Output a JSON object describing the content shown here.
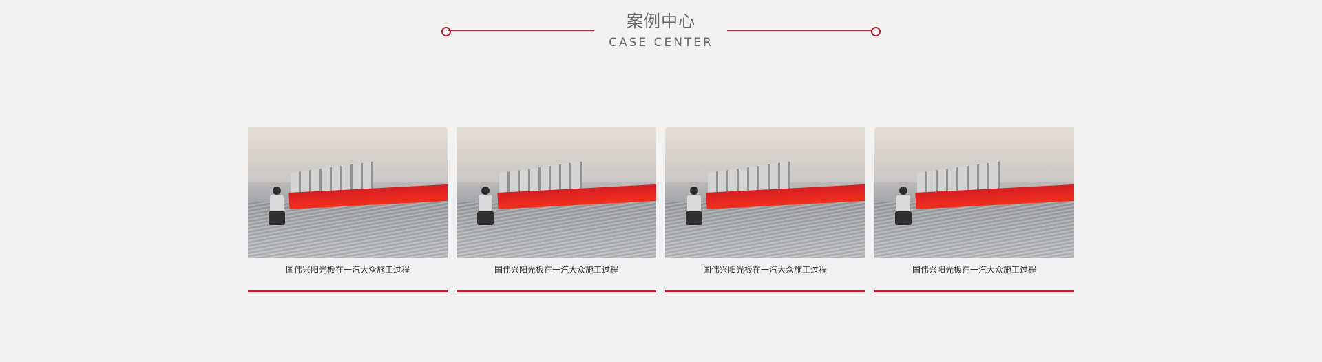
{
  "section": {
    "title_cn": "案例中心",
    "title_en": "CASE CENTER"
  },
  "cases": [
    {
      "caption": "国伟兴阳光板在一汽大众施工过程"
    },
    {
      "caption": "国伟兴阳光板在一汽大众施工过程"
    },
    {
      "caption": "国伟兴阳光板在一汽大众施工过程"
    },
    {
      "caption": "国伟兴阳光板在一汽大众施工过程"
    }
  ],
  "colors": {
    "accent": "#b51e2a",
    "background": "#f2f2f2",
    "heading_text": "#666666"
  },
  "icons": {
    "decor_left": "ring-icon",
    "decor_right": "ring-icon"
  }
}
